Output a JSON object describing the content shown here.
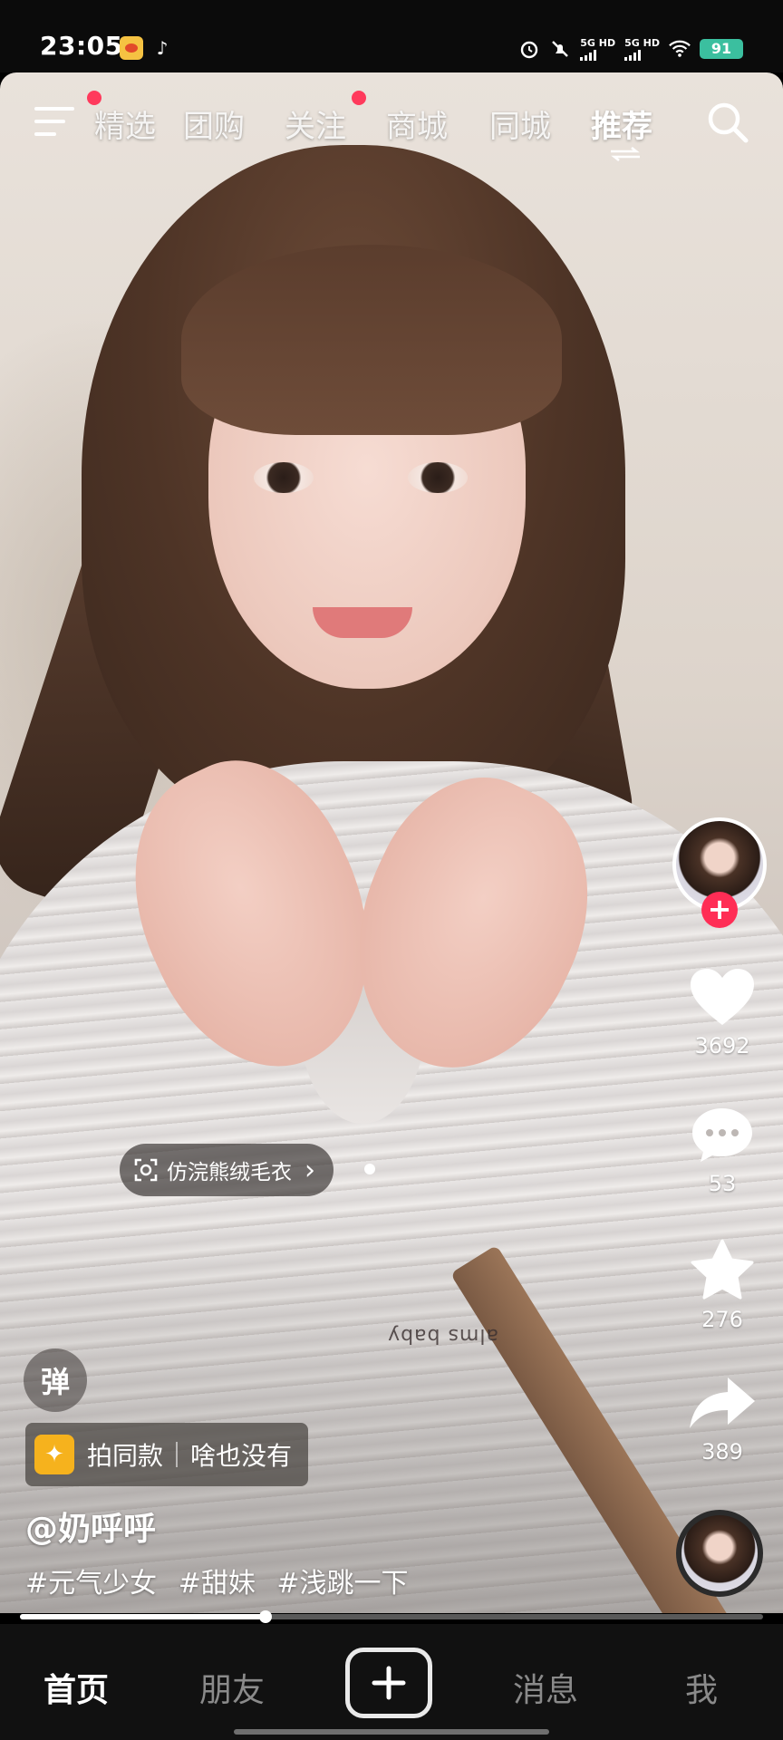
{
  "status_bar": {
    "time": "23:05",
    "network_1": "5G HD",
    "network_2": "5G HD",
    "battery": "91",
    "icons": [
      "weibo-icon",
      "tiktok-icon",
      "alarm-icon",
      "mute-icon",
      "signal-icon",
      "wifi-icon",
      "battery-icon"
    ]
  },
  "top_nav": {
    "tabs": [
      {
        "label": "精选"
      },
      {
        "label": "团购"
      },
      {
        "label": "关注"
      },
      {
        "label": "商城"
      },
      {
        "label": "同城"
      },
      {
        "label": "推荐"
      }
    ],
    "active_tab": "推荐",
    "icons": [
      "menu-icon",
      "refresh-icon",
      "search-icon"
    ]
  },
  "side_actions": {
    "like_count": "3692",
    "comment_count": "53",
    "favorite_count": "276",
    "share_count": "389",
    "follow_symbol": "+"
  },
  "product_tag": {
    "label": "仿浣熊绒毛衣",
    "icon": "scan-icon",
    "arrow": "›"
  },
  "info": {
    "danmu_label": "弹",
    "template_action": "拍同款",
    "template_desc": "啥也没有",
    "username": "@奶呼呼",
    "hashtags": [
      "#元气少女",
      "#甜妹",
      "#浅跳一下"
    ],
    "shirt_print": "alms baby"
  },
  "playback": {
    "progress": 0.33
  },
  "bottom_nav": {
    "items": [
      "首页",
      "朋友",
      "消息",
      "我"
    ],
    "active": "首页"
  },
  "colors": {
    "accent_red": "#ff2d55",
    "battery_green": "#3bbf9f",
    "template_yellow": "#f6b21d"
  }
}
